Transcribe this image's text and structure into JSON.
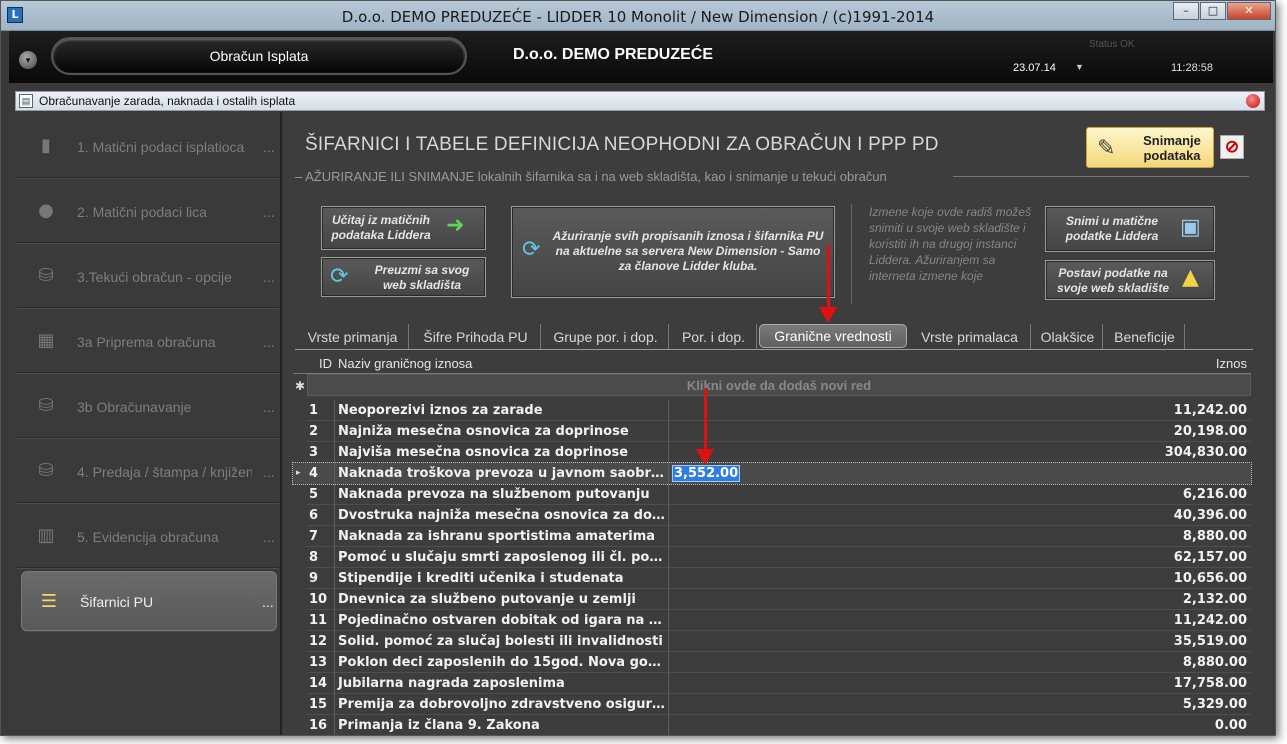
{
  "window": {
    "title": "D.o.o. DEMO PREDUZEĆE - LIDDER 10 Monolit / New Dimension / (c)1991-2014",
    "app_icon": "L",
    "min_icon": "minimize-icon",
    "max_icon": "maximize-icon",
    "close_icon": "close-icon"
  },
  "header": {
    "module_title": "Obračun Isplata",
    "company": "D.o.o. DEMO PREDUZEĆE",
    "status": "Status OK",
    "date": "23.07.14",
    "time": "11:28:58"
  },
  "subwindow": {
    "title": "Obračunavanje zarada, naknada i ostalih isplata"
  },
  "sidebar": {
    "items": [
      {
        "label": "1. Matični podaci isplatioca",
        "dots": "...",
        "icon": "building-icon"
      },
      {
        "label": "2. Matični podaci lica",
        "dots": "...",
        "icon": "person-icon"
      },
      {
        "label": "3.Tekući obračun - opcije",
        "dots": "...",
        "icon": "database-check-icon"
      },
      {
        "label": "3a Priprema obračuna",
        "dots": "...",
        "icon": "calculator-icon"
      },
      {
        "label": "3b Obračunavanje",
        "dots": "...",
        "icon": "database-gear-icon"
      },
      {
        "label": "4. Predaja / štampa / knjiženje",
        "dots": "...",
        "icon": "database-info-icon"
      },
      {
        "label": "5. Evidencija obračuna",
        "dots": "...",
        "icon": "archive-icon"
      },
      {
        "label": "Šifarnici PU",
        "dots": "...",
        "icon": "table-list-icon"
      }
    ]
  },
  "main": {
    "title": "ŠIFARNICI I TABELE DEFINICIJA NEOPHODNI ZA OBRAČUN I PPP PD",
    "subtitle": "– AŽURIRANJE ILI SNIMANJE lokalnih šifarnika sa i na web skladišta, kao i snimanje u tekući obračun",
    "save_label": "Snimanje podataka",
    "stop_icon": "no-entry-icon",
    "btn_load_liddera": "Učitaj iz matičnih podataka Liddera",
    "btn_fetch_web": "Preuzmi sa svog web skladišta",
    "btn_update_all": "Ažuriranje svih propisanih iznosa i šifarnika PU na aktuelne sa servera New Dimension - Samo za članove Lidder kluba.",
    "info_note": "Izmene koje ovde radiš možeš snimiti u svoje web skladište i koristiti ih na drugoj instanci Liddera. Ažuriranjem sa interneta izmene koje",
    "btn_save_liddera": "Snimi u matične podatke Liddera",
    "btn_post_web": "Postavi podatke na svoje web skladište"
  },
  "tabs": [
    "Vrste primanja",
    "Šifre Prihoda PU",
    "Grupe por. i dop.",
    "Por. i dop.",
    "Granične vrednosti",
    "Vrste primalaca",
    "Olakšice",
    "Beneficije"
  ],
  "grid": {
    "columns": {
      "id": "ID",
      "name": "Naziv graničnog iznosa",
      "amount": "Iznos"
    },
    "new_row_marker": "✱",
    "new_row_text": "Klikni ovde da dodaš novi red",
    "rows": [
      {
        "id": "1",
        "name": "Neoporezivi iznos za zarade",
        "amount": "11,242.00"
      },
      {
        "id": "2",
        "name": "Najniža mesečna osnovica za doprinose",
        "amount": "20,198.00"
      },
      {
        "id": "3",
        "name": "Najviša mesečna osnovica za doprinose",
        "amount": "304,830.00"
      },
      {
        "id": "4",
        "name": "Naknada troškova prevoza u javnom saobr…",
        "amount": "3,552.00"
      },
      {
        "id": "5",
        "name": "Naknada prevoza na službenom putovanju",
        "amount": "6,216.00"
      },
      {
        "id": "6",
        "name": "Dvostruka najniža mesečna osnovica za do…",
        "amount": "40,396.00"
      },
      {
        "id": "7",
        "name": "Naknada za ishranu sportistima amaterima",
        "amount": "8,880.00"
      },
      {
        "id": "8",
        "name": "Pomoć u slučaju smrti zaposlenog ili čl. por…",
        "amount": "62,157.00"
      },
      {
        "id": "9",
        "name": "Stipendije i krediti učenika i studenata",
        "amount": "10,656.00"
      },
      {
        "id": "10",
        "name": "Dnevnica za službeno putovanje u zemlji",
        "amount": "2,132.00"
      },
      {
        "id": "11",
        "name": "Pojedinačno ostvaren dobitak od igara na s…",
        "amount": "11,242.00"
      },
      {
        "id": "12",
        "name": "Solid. pomoć za slučaj bolesti ili invalidnosti",
        "amount": "35,519.00"
      },
      {
        "id": "13",
        "name": "Poklon deci zaposlenih  do 15god. Nova go…",
        "amount": "8,880.00"
      },
      {
        "id": "14",
        "name": "Jubilarna nagrada zaposlenima",
        "amount": "17,758.00"
      },
      {
        "id": "15",
        "name": "Premija za dobrovoljno zdravstveno osigur…",
        "amount": "5,329.00"
      },
      {
        "id": "16",
        "name": "Primanja iz člana 9. Zakona",
        "amount": "0.00"
      }
    ],
    "selected_index": 3
  },
  "colors": {
    "accent_red": "#e01010",
    "selection_blue": "#2f7de1",
    "save_yellow": "#f4d77a"
  }
}
